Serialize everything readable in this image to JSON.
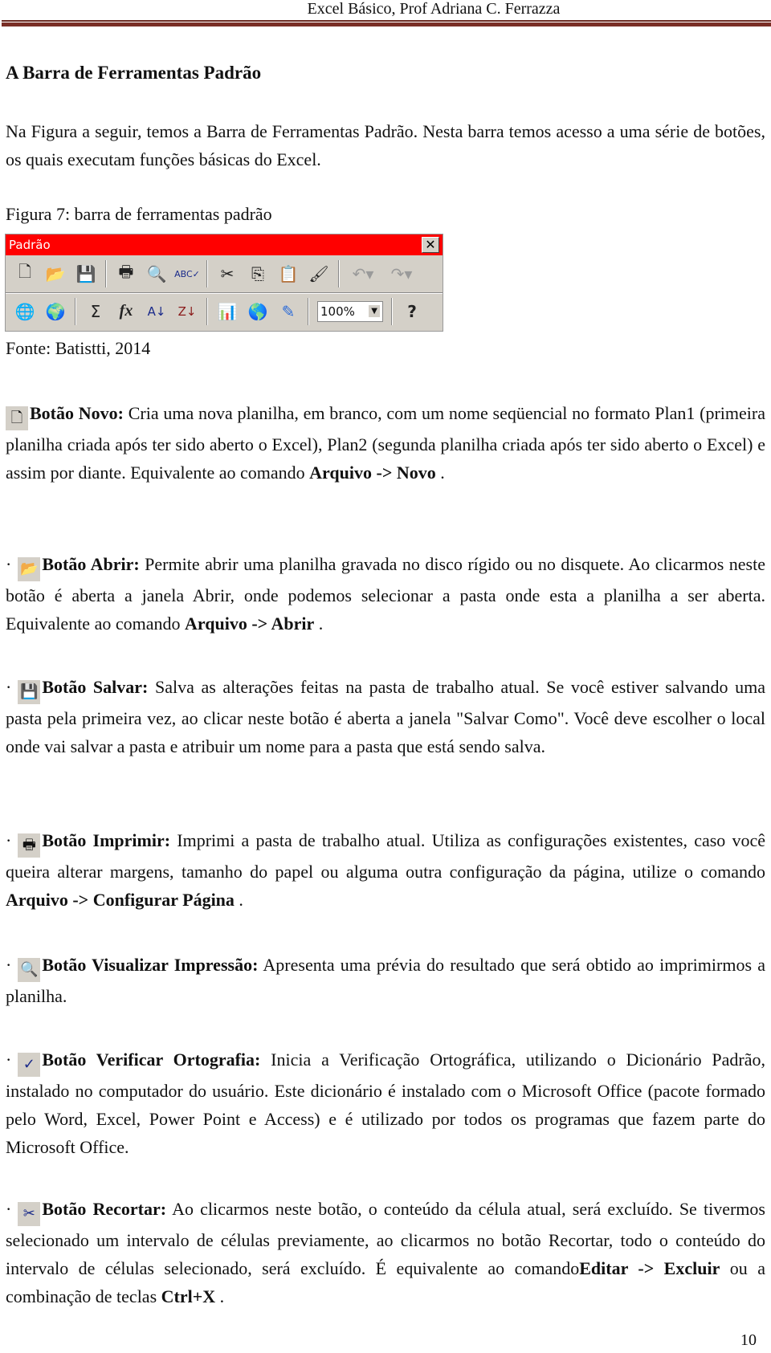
{
  "header": {
    "title": "Excel Básico, Prof Adriana C. Ferrazza",
    "rule_color": "#7a2e26"
  },
  "section_title": "A Barra de Ferramentas Padrão",
  "intro": "Na Figura a seguir, temos a Barra de Ferramentas Padrão. Nesta barra temos acesso a uma série de botões, os quais executam funções básicas do Excel.",
  "figure": {
    "caption": "Figura 7: barra de ferramentas padrão",
    "source": "Fonte: Batistti, 2014",
    "toolbar": {
      "title": "Padrão",
      "titlebar_color": "#ff0000",
      "close_glyph": "✕",
      "row1": [
        {
          "name": "new",
          "glyph": "🗋"
        },
        {
          "name": "open",
          "glyph": "📂"
        },
        {
          "name": "save",
          "glyph": "💾"
        },
        {
          "name": "print",
          "glyph": "🖶"
        },
        {
          "name": "print-preview",
          "glyph": "🔍"
        },
        {
          "name": "spelling",
          "glyph": "ABC✓"
        },
        {
          "name": "cut",
          "glyph": "✂"
        },
        {
          "name": "copy",
          "glyph": "⎘"
        },
        {
          "name": "paste",
          "glyph": "📋"
        },
        {
          "name": "format-painter",
          "glyph": "🖌"
        },
        {
          "name": "undo",
          "glyph": "↶▾"
        },
        {
          "name": "redo",
          "glyph": "↷▾"
        }
      ],
      "row2": [
        {
          "name": "insert-hyperlink",
          "glyph": "🌐"
        },
        {
          "name": "web-toolbar",
          "glyph": "🌍"
        },
        {
          "name": "autosum",
          "glyph": "Σ"
        },
        {
          "name": "paste-function",
          "glyph": "fx"
        },
        {
          "name": "sort-ascending",
          "glyph": "A↓"
        },
        {
          "name": "sort-descending",
          "glyph": "Z↓"
        },
        {
          "name": "chart-wizard",
          "glyph": "📊"
        },
        {
          "name": "map",
          "glyph": "🌎"
        },
        {
          "name": "drawing",
          "glyph": "✎"
        },
        {
          "name": "help",
          "glyph": "?"
        }
      ],
      "zoom_value": "100%"
    }
  },
  "buttons": [
    {
      "title": "Botão Novo:",
      "icon": "🗋",
      "text": " Cria uma nova planilha, em branco, com um nome seqüencial no formato Plan1 (primeira planilha criada após ter sido aberto o Excel), Plan2 (segunda planilha criada após ter sido aberto o Excel) e assim por diante. Equivalente ao comando ",
      "command": "Arquivo -> Novo",
      "tail": " ."
    },
    {
      "title": "Botão Abrir:",
      "icon": "📂",
      "text": " Permite abrir uma planilha gravada no disco rígido ou no disquete. Ao clicarmos neste botão é aberta a janela Abrir, onde podemos selecionar a pasta onde esta a planilha a ser aberta. Equivalente ao comando ",
      "command": "Arquivo -> Abrir",
      "tail": " ."
    },
    {
      "title": "Botão Salvar:",
      "icon": "💾",
      "text": " Salva as alterações feitas na pasta de trabalho atual. Se você estiver salvando uma pasta pela primeira vez, ao clicar neste botão é aberta a janela \"Salvar Como\". Você deve escolher o local onde vai salvar a pasta e atribuir um nome para a pasta que está sendo salva."
    },
    {
      "title": "Botão Imprimir:",
      "icon": "🖶",
      "text": " Imprimi a pasta de trabalho atual. Utiliza as configurações existentes, caso você queira alterar margens, tamanho do papel ou alguma outra configuração da página, utilize o comando ",
      "command": "Arquivo -> Configurar Página",
      "tail": " ."
    },
    {
      "title": "Botão Visualizar Impressão:",
      "icon": "🔍",
      "text": " Apresenta uma prévia do resultado que será obtido ao imprimirmos a planilha."
    },
    {
      "title": "Botão Verificar Ortografia:",
      "icon": "✓",
      "text": " Inicia a Verificação Ortográfica, utilizando o Dicionário Padrão, instalado no computador do usuário. Este dicionário é instalado com o Microsoft Office (pacote formado pelo Word, Excel, Power Point e Access) e é utilizado por todos os programas que fazem parte do Microsoft Office."
    },
    {
      "title": "Botão Recortar:",
      "icon": "✂",
      "text": " Ao clicarmos neste botão, o conteúdo da célula atual, será excluído. Se tivermos selecionado um intervalo de células previamente, ao clicarmos no botão Recortar, todo o conteúdo do intervalo de células selecionado, será excluído. É equivalente ao comando",
      "command": "Editar -> Excluir",
      "text2": " ou a combinação de teclas ",
      "keys": "Ctrl+X",
      "tail": " ."
    }
  ],
  "bullet_glyph": "·",
  "page_number": "10"
}
